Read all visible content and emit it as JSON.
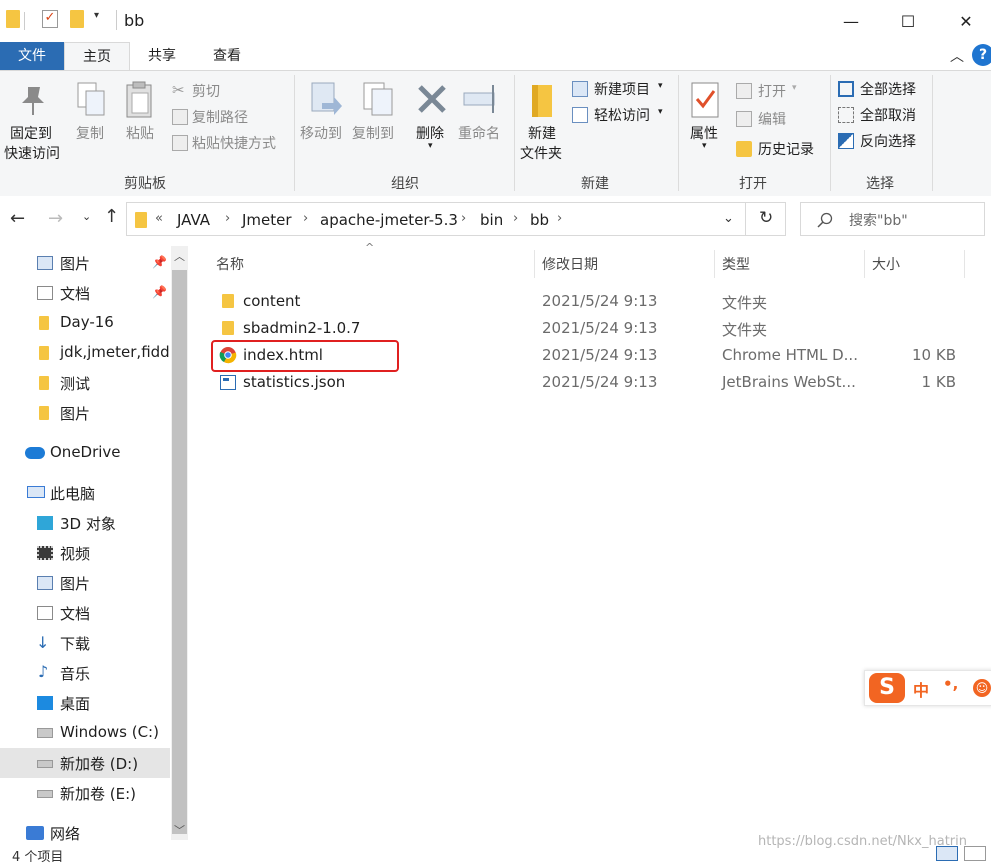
{
  "window": {
    "title": "bb",
    "minimize": "—",
    "maximize": "☐",
    "close": "✕"
  },
  "ribbon_tabs": [
    "文件",
    "主页",
    "共享",
    "查看"
  ],
  "ribbon": {
    "clipboard": {
      "pin_quick_access_line1": "固定到",
      "pin_quick_access_line2": "快速访问",
      "copy": "复制",
      "paste": "粘贴",
      "cut": "剪切",
      "copy_path": "复制路径",
      "paste_shortcut": "粘贴快捷方式",
      "group": "剪贴板"
    },
    "organize": {
      "move_to": "移动到",
      "copy_to": "复制到",
      "delete": "删除",
      "rename": "重命名",
      "group": "组织"
    },
    "new": {
      "new_folder_line1": "新建",
      "new_folder_line2": "文件夹",
      "new_item": "新建项目",
      "easy_access": "轻松访问",
      "group": "新建"
    },
    "open": {
      "properties": "属性",
      "open": "打开",
      "edit": "编辑",
      "history": "历史记录",
      "group": "打开"
    },
    "select": {
      "select_all": "全部选择",
      "select_none": "全部取消",
      "invert": "反向选择",
      "group": "选择"
    }
  },
  "address": {
    "overflow": "«",
    "crumbs": [
      "JAVA",
      "Jmeter",
      "apache-jmeter-5.3",
      "bin",
      "bb"
    ],
    "search_placeholder": "搜索\"bb\""
  },
  "sidebar": {
    "quick": [
      {
        "label": "图片",
        "icon": "pictures-icon",
        "pinned": true
      },
      {
        "label": "文档",
        "icon": "documents-icon",
        "pinned": true
      },
      {
        "label": "Day-16",
        "icon": "folder-icon"
      },
      {
        "label": "jdk,jmeter,fiddl",
        "icon": "folder-icon"
      },
      {
        "label": "测试",
        "icon": "folder-icon"
      },
      {
        "label": "图片",
        "icon": "folder-icon"
      }
    ],
    "onedrive": "OneDrive",
    "this_pc": "此电脑",
    "pc_items": [
      {
        "label": "3D 对象",
        "icon": "3d-objects-icon"
      },
      {
        "label": "视频",
        "icon": "videos-icon"
      },
      {
        "label": "图片",
        "icon": "pictures-icon"
      },
      {
        "label": "文档",
        "icon": "documents-icon"
      },
      {
        "label": "下载",
        "icon": "downloads-icon"
      },
      {
        "label": "音乐",
        "icon": "music-icon"
      },
      {
        "label": "桌面",
        "icon": "desktop-icon"
      },
      {
        "label": "Windows (C:)",
        "icon": "drive-icon"
      },
      {
        "label": "新加卷 (D:)",
        "icon": "drive-icon",
        "selected": true
      },
      {
        "label": "新加卷 (E:)",
        "icon": "drive-icon"
      }
    ],
    "network": "网络"
  },
  "columns": {
    "name": "名称",
    "date": "修改日期",
    "type": "类型",
    "size": "大小"
  },
  "files": [
    {
      "name": "content",
      "date": "2021/5/24 9:13",
      "type": "文件夹",
      "size": "",
      "icon": "folder-icon"
    },
    {
      "name": "sbadmin2-1.0.7",
      "date": "2021/5/24 9:13",
      "type": "文件夹",
      "size": "",
      "icon": "folder-icon"
    },
    {
      "name": "index.html",
      "date": "2021/5/24 9:13",
      "type": "Chrome HTML D...",
      "size": "10 KB",
      "icon": "chrome-icon"
    },
    {
      "name": "statistics.json",
      "date": "2021/5/24 9:13",
      "type": "JetBrains WebSt...",
      "size": "1 KB",
      "icon": "json-file-icon"
    }
  ],
  "status": "4 个项目",
  "ime": {
    "logo": "S",
    "mode": "中",
    "punct": "•,"
  },
  "watermark": "https://blog.csdn.net/Nkx_hatrin",
  "colors": {
    "accent": "#2b6cb3",
    "folder": "#f5c542",
    "highlight": "#e02020"
  }
}
